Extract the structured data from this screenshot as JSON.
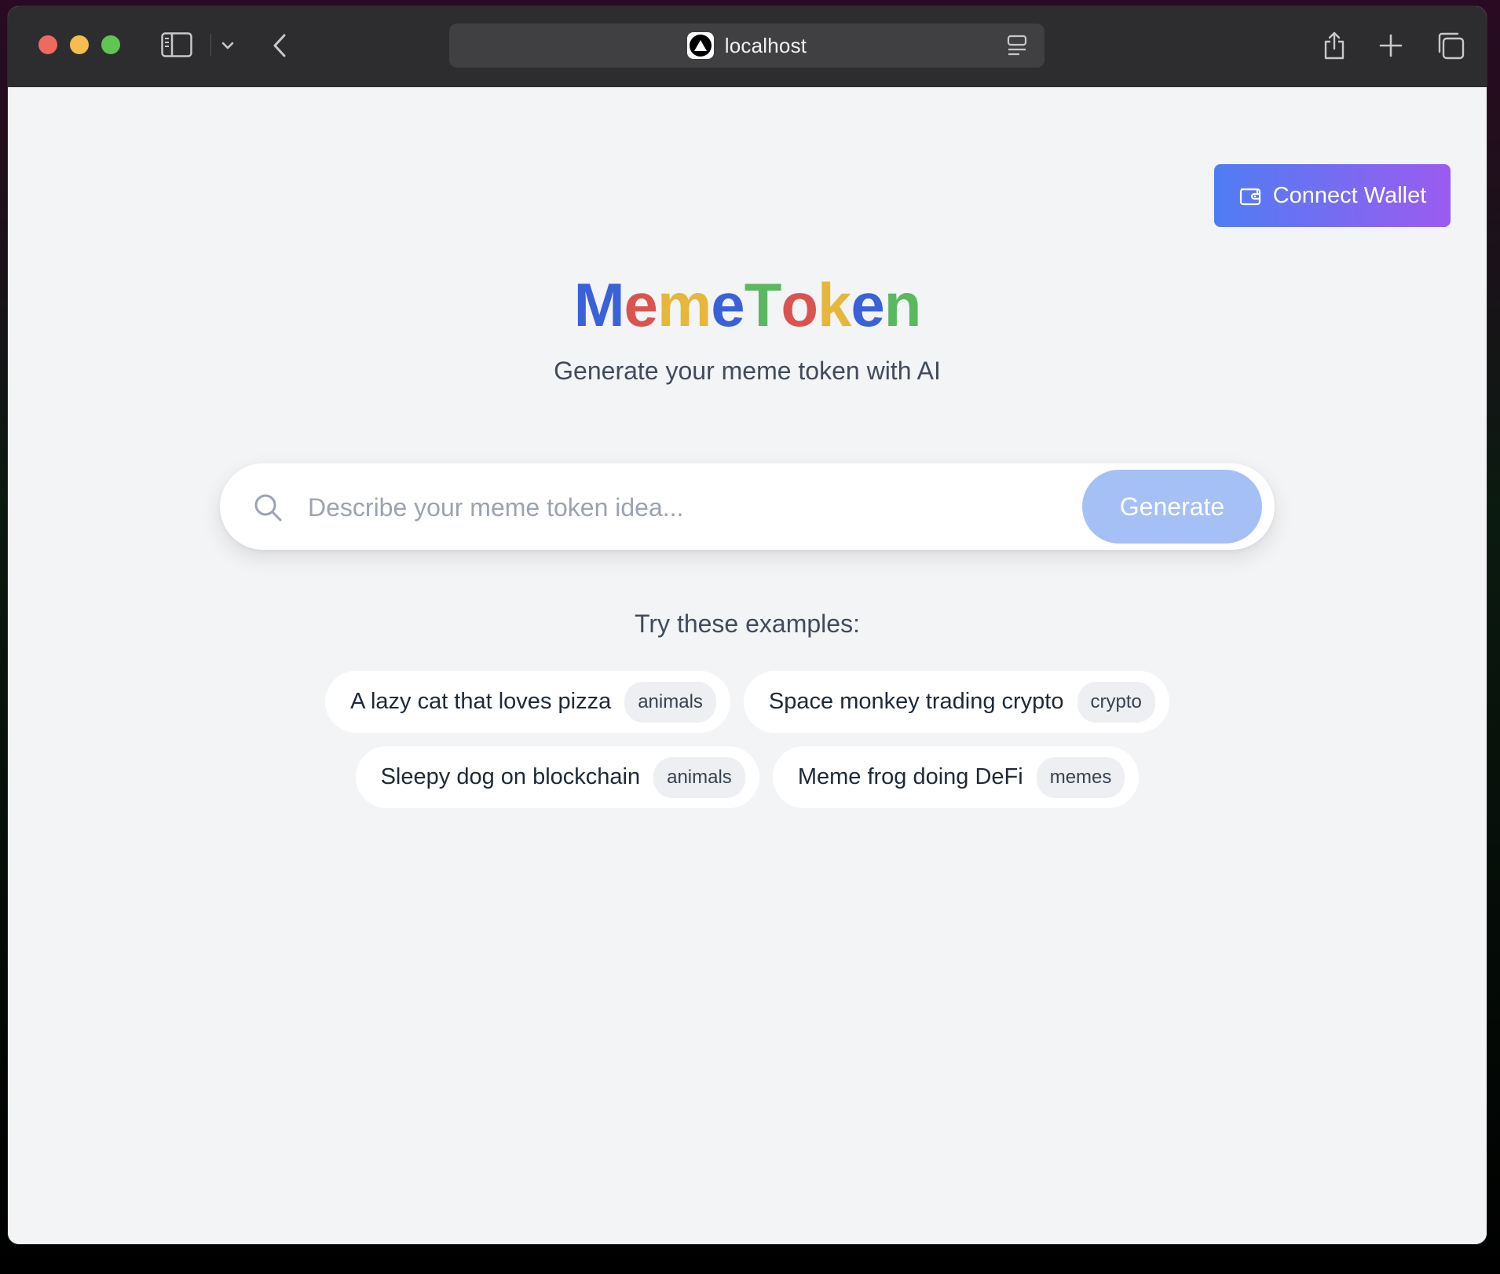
{
  "browser": {
    "address": "localhost"
  },
  "header": {
    "connect_wallet_label": "Connect Wallet"
  },
  "logo": {
    "letters": [
      {
        "char": "M",
        "color": "#3a61d8"
      },
      {
        "char": "e",
        "color": "#d9534f"
      },
      {
        "char": "m",
        "color": "#e5b73b"
      },
      {
        "char": "e",
        "color": "#3a61d8"
      },
      {
        "char": "T",
        "color": "#5cb860"
      },
      {
        "char": "o",
        "color": "#d9534f"
      },
      {
        "char": "k",
        "color": "#e5b73b"
      },
      {
        "char": "e",
        "color": "#3a61d8"
      },
      {
        "char": "n",
        "color": "#5cb860"
      }
    ]
  },
  "hero": {
    "subtitle": "Generate your meme token with AI"
  },
  "search": {
    "placeholder": "Describe your meme token idea...",
    "value": "",
    "generate_label": "Generate"
  },
  "examples": {
    "title": "Try these examples:",
    "rows": [
      [
        {
          "text": "A lazy cat that loves pizza",
          "tag": "animals"
        },
        {
          "text": "Space monkey trading crypto",
          "tag": "crypto"
        }
      ],
      [
        {
          "text": "Sleepy dog on blockchain",
          "tag": "animals"
        },
        {
          "text": "Meme frog doing DeFi",
          "tag": "memes"
        }
      ]
    ]
  },
  "colors": {
    "accent_gradient_start": "#4f7df3",
    "accent_gradient_end": "#9b5cf0",
    "generate_disabled": "#a5c0f5",
    "page_background": "#f3f4f6"
  }
}
